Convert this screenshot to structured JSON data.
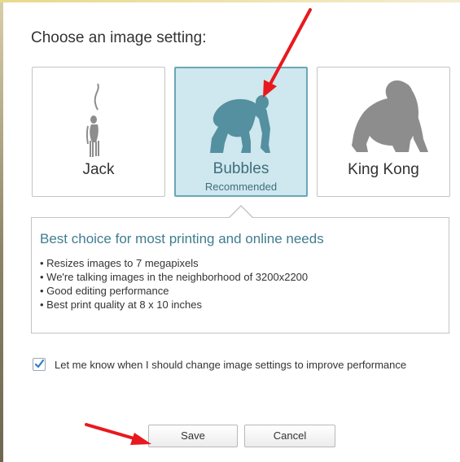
{
  "dialog": {
    "title": "Choose an image setting:"
  },
  "options": [
    {
      "label": "Jack",
      "sublabel": "",
      "selected": false,
      "icon": "monkey-icon"
    },
    {
      "label": "Bubbles",
      "sublabel": "Recommended",
      "selected": true,
      "icon": "chimpanzee-icon"
    },
    {
      "label": "King Kong",
      "sublabel": "",
      "selected": false,
      "icon": "gorilla-icon"
    }
  ],
  "info": {
    "heading": "Best choice for most printing and online needs",
    "bullets": [
      "Resizes images to 7 megapixels",
      "We're talking images in the neighborhood of 3200x2200",
      "Good editing performance",
      "Best print quality at 8 x 10 inches"
    ]
  },
  "notify": {
    "checked": true,
    "label": "Let me know when I should change image settings to improve performance"
  },
  "buttons": {
    "save": "Save",
    "cancel": "Cancel"
  },
  "colors": {
    "accent": "#3f7d8f",
    "selected_bg": "#cfe7ee",
    "annotation_arrow": "#e8191e"
  }
}
